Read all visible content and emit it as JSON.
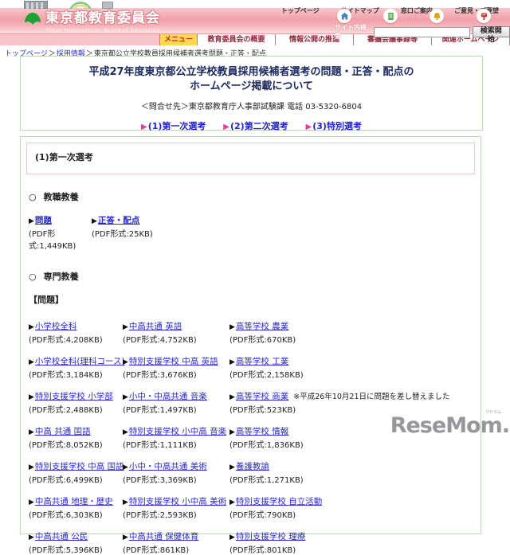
{
  "glyphs": {
    "bullet": "▶",
    "circle": "○",
    "separator": "＞"
  },
  "colors": {
    "header_pink": "#f2a0a9",
    "menu_yellow": "#ffd94d",
    "menu_text_red": "#8f2436",
    "link_blue": "#2929c8",
    "anchor_bullet_magenta": "#e0409a",
    "box_border_green": "#b9dcae",
    "box_border_pink": "#eec9c9",
    "title_navy": "#1c2a60",
    "leaf_green": "#1fa138",
    "watermark_gray": "#97979b"
  },
  "topbar": {
    "links": [
      "トップページ",
      "サイトマップ",
      "窓口ご案内",
      "ご意見・ご要望"
    ]
  },
  "header": {
    "logo_title": "東京都教育委員会",
    "logo_subtitle": "Tokyo Metropolitan Board of Education",
    "search_label": "サイト内検索",
    "search_value": "",
    "search_button": "検索開始"
  },
  "menu": {
    "active": "メニュー",
    "items": [
      "教育委員会の概要",
      "情報公開の推進",
      "審議会議事録等",
      "関連ホームページ"
    ]
  },
  "breadcrumb": {
    "links": [
      "トップページ",
      "採用情報"
    ],
    "current": "東京都公立学校教員採用候補者選考問題・正答・配点"
  },
  "title_box": {
    "title_line1": "平成27年度東京都公立学校教員採用候補者選考の問題・正答・配点の",
    "title_line2": "ホームページ掲載について",
    "contact": "＜問合せ先＞東京都教育庁人事部試験課 電話 03-5320-6804",
    "anchors": [
      "(1)第一次選考",
      "(2)第二次選考",
      "(3)特別選考"
    ]
  },
  "content": {
    "section_title": "(1)第一次選考",
    "kyoshoku": {
      "heading": "教職教養",
      "links": [
        {
          "label": "問題",
          "size": "(PDF形式:1,449KB)"
        },
        {
          "label": "正答・配点",
          "size": "(PDF形式:25KB)"
        }
      ]
    },
    "senmon": {
      "heading": "専門教養",
      "subheading": "【問題】",
      "grid": [
        [
          {
            "label": "小学校全科",
            "size": "(PDF形式:4,208KB)"
          },
          {
            "label": "中高共通 英語",
            "size": "(PDF形式:4,752KB)"
          },
          {
            "label": "高等学校 農業",
            "size": "(PDF形式:670KB)"
          }
        ],
        [
          {
            "label": "小学校全科(理科コース)",
            "size": "(PDF形式:3,184KB)"
          },
          {
            "label": "特別支援学校 中高 英語",
            "size": "(PDF形式:3,676KB)"
          },
          {
            "label": "高等学校 工業",
            "size": "(PDF形式:2,158KB)"
          }
        ],
        [
          {
            "label": "特別支援学校 小学部",
            "size": "(PDF形式:2,488KB)"
          },
          {
            "label": "小中・中高共通 音楽",
            "size": "(PDF形式:1,497KB)"
          },
          {
            "label": "高等学校 商業",
            "size": "(PDF形式:523KB)",
            "note": "※平成26年10月21日に問題を差し替えました"
          }
        ],
        [
          {
            "label": "中高 共通 国語",
            "size": "(PDF形式:8,052KB)"
          },
          {
            "label": "特別支援学校 小中高 音楽",
            "size": "(PDF形式:1,111KB)"
          },
          {
            "label": "高等学校 情報",
            "size": "(PDF形式:1,836KB)"
          }
        ],
        [
          {
            "label": "特別支援学校 中高 国語",
            "size": "(PDF形式:6,499KB)"
          },
          {
            "label": "小中・中高共通 美術",
            "size": "(PDF形式:3,369KB)"
          },
          {
            "label": "養護教諭",
            "size": "(PDF形式:1,271KB)"
          }
        ],
        [
          {
            "label": "中高共通 地理・歴史",
            "size": "(PDF形式:6,303KB)"
          },
          {
            "label": "特別支援学校 小中高 美術",
            "size": "(PDF形式:2,593KB)"
          },
          {
            "label": "特別支援学校 自立活動",
            "size": "(PDF形式:790KB)"
          }
        ],
        [
          {
            "label": "中高共通 公民",
            "size": "(PDF形式:5,396KB)"
          },
          {
            "label": "中高共通 保健体育",
            "size": "(PDF形式:861KB)"
          },
          {
            "label": "特別支援学校 理療",
            "size": "(PDF形式:801KB)"
          }
        ]
      ]
    }
  },
  "watermark": {
    "text": "ReseMom.",
    "small": "リセマム"
  }
}
